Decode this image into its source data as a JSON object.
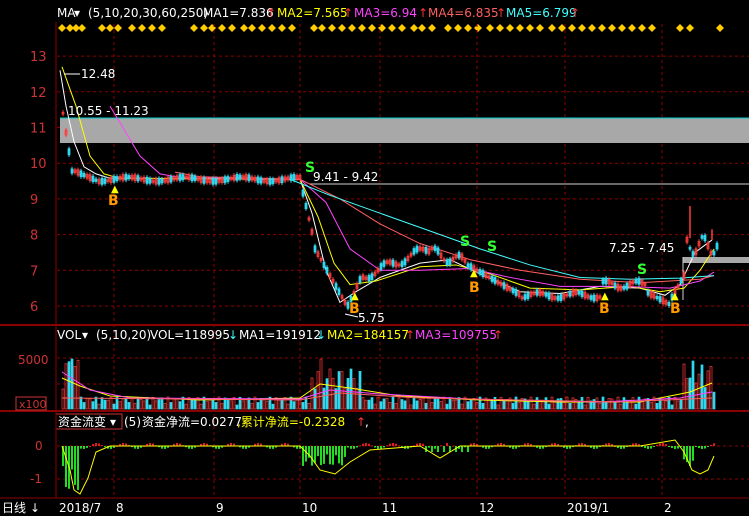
{
  "colors": {
    "bg": "#000000",
    "grid": "#8b0000",
    "axis_text": "#cc3333",
    "up": "#ff3b3b",
    "down": "#2fd9ef",
    "ma1": "#ffffff",
    "ma2": "#ffff00",
    "ma3": "#ff44ff",
    "ma4": "#ff6060",
    "ma5": "#44ffff",
    "white_text": "#ffffff",
    "signal_s": "#33ff33",
    "signal_b": "#ff9900",
    "band": "#a8a8a8",
    "band_line": "#00cccc",
    "flow_up": "#e02020",
    "flow_down": "#22dd22"
  },
  "main_header": {
    "indicator": "MA",
    "params": "(5,10,20,30,60,250)",
    "ma1": "MA1=7.836",
    "ma2": "MA2=7.565",
    "ma3": "MA3=6.94",
    "ma4": "MA4=6.835",
    "ma5": "MA5=6.799"
  },
  "price_axis": [
    "13",
    "12",
    "11",
    "10",
    "9",
    "8",
    "7",
    "6"
  ],
  "annotations": {
    "high": "12.48",
    "low": "5.75",
    "band1": "10.55 - 11.23",
    "band2": "9.41 - 9.42",
    "band3": "7.25 - 7.45"
  },
  "signals": {
    "b": "B",
    "s": "S"
  },
  "vol_header": {
    "indicator": "VOL",
    "params": "(5,10,20)",
    "vol": "VOL=118995",
    "ma1": "MA1=191912",
    "ma2": "MA2=184157",
    "ma3": "MA3=109755"
  },
  "vol_axis": {
    "top": "5000",
    "unit": "x100"
  },
  "flow_header": {
    "indicator": "资金流变",
    "params": "(5)",
    "net": "资金净流=0.0277",
    "cum": ",累计净流=-0.2328",
    "tail": ","
  },
  "flow_axis": [
    "0",
    "-1"
  ],
  "period_tab": "日线",
  "date_axis": [
    "2018/7",
    "8",
    "9",
    "10",
    "11",
    "12",
    "2019/1",
    "2"
  ]
}
